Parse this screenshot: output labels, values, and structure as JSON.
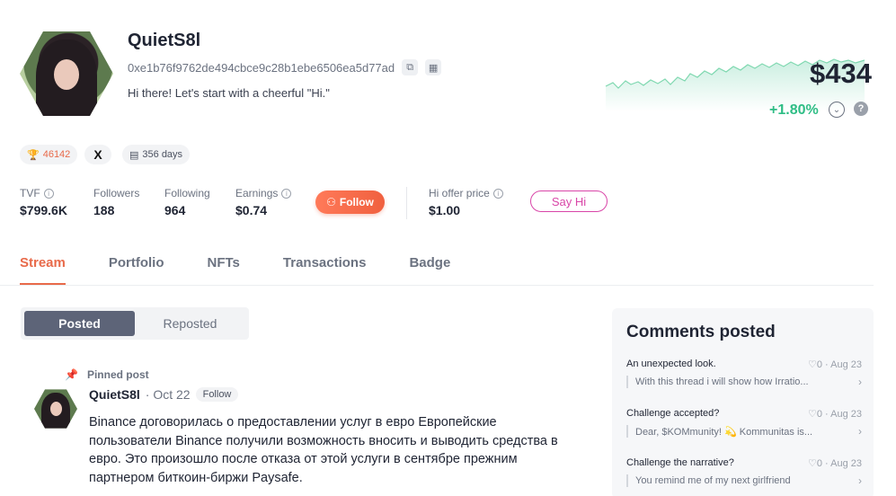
{
  "profile": {
    "username": "QuietS8l",
    "address": "0xe1b76f9762de494cbce9c28b1ebe6506ea5d77ad",
    "bio": "Hi there! Let's start with a cheerful \"Hi.\"",
    "price": "$434",
    "change": "+1.80%"
  },
  "chips": {
    "trophy": "46142",
    "x": "X",
    "days": "356 days"
  },
  "stats": [
    {
      "label": "TVF",
      "value": "$799.6K",
      "info": true
    },
    {
      "label": "Followers",
      "value": "188",
      "info": false
    },
    {
      "label": "Following",
      "value": "964",
      "info": false
    },
    {
      "label": "Earnings",
      "value": "$0.74",
      "info": true
    }
  ],
  "actions": {
    "follow_label": "Follow",
    "hi_offer_label": "Hi offer price",
    "hi_offer_value": "$1.00",
    "sayhi_label": "Say Hi"
  },
  "tabs": [
    "Stream",
    "Portfolio",
    "NFTs",
    "Transactions",
    "Badge"
  ],
  "segment": {
    "posted": "Posted",
    "reposted": "Reposted"
  },
  "post": {
    "pinned_label": "Pinned post",
    "author": "QuietS8l",
    "date": "· Oct 22",
    "follow": "Follow",
    "body": "Binance договорилась о предоставлении услуг в евро Европейские пользователи Binance получили возможность вносить и выводить средства в евро. Это произошло после отказа от этой услуги в сентябре прежним партнером биткоин-биржи Paysafe."
  },
  "comments": {
    "title": "Comments posted",
    "items": [
      {
        "title": "An unexpected look.",
        "meta": "♡0 · Aug 23",
        "reply": "With this thread i will show how Irratio..."
      },
      {
        "title": "Challenge accepted?",
        "meta": "♡0 · Aug 23",
        "reply": "Dear, $KOMmunity! 💫 Kommunitas is..."
      },
      {
        "title": "Challenge the narrative?",
        "meta": "♡0 · Aug 23",
        "reply": "You remind me of my next girlfriend"
      }
    ]
  },
  "colors": {
    "accent": "#e86a4a",
    "positive": "#2ebd85",
    "sayhi": "#d946a8"
  }
}
